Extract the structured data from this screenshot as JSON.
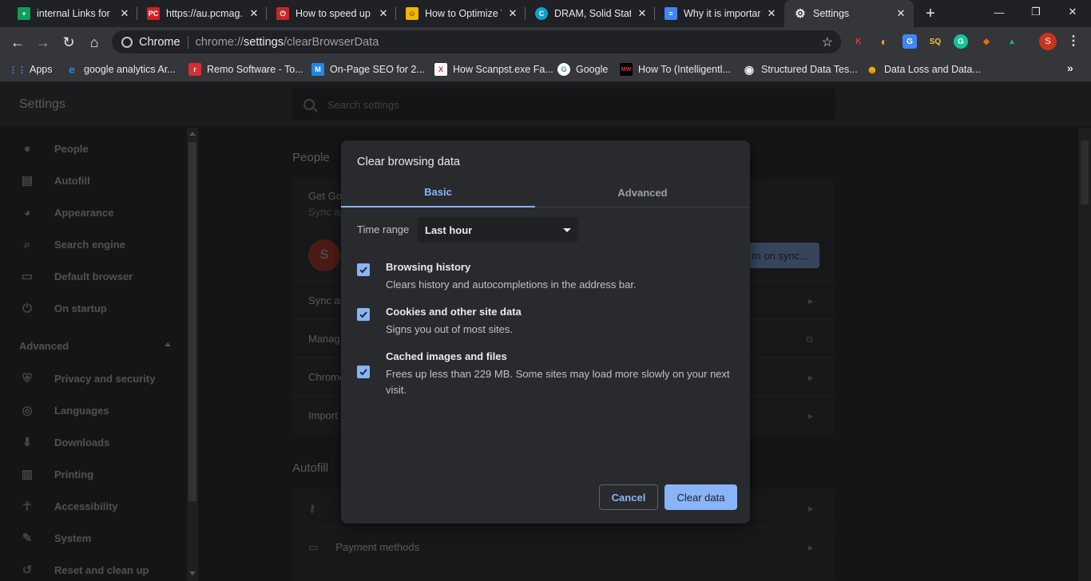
{
  "tabs": [
    {
      "title": "internal Links for P",
      "favicon": "sheets-icon",
      "color": "#0f9d58",
      "glyph": "+"
    },
    {
      "title": "https://au.pcmag.c",
      "favicon": "pcmag-icon",
      "color": "#d21f26",
      "glyph": "PC"
    },
    {
      "title": "How to speed up W",
      "favicon": "power-icon",
      "color": "#c62828",
      "glyph": "⏻"
    },
    {
      "title": "How to Optimize W",
      "favicon": "smiley-icon",
      "color": "#f4b400",
      "glyph": "☺"
    },
    {
      "title": "DRAM, Solid State",
      "favicon": "c-icon",
      "color": "#0aa2d4",
      "glyph": "C"
    },
    {
      "title": "Why it is importan",
      "favicon": "docs-icon",
      "color": "#4285f4",
      "glyph": "≡"
    },
    {
      "title": "Settings",
      "favicon": "gear-icon",
      "color": "#35363a",
      "glyph": "⚙"
    }
  ],
  "window": {
    "minimize": "—",
    "restore": "❐",
    "close": "✕",
    "new_tab": "+"
  },
  "omnibox": {
    "chip": "Chrome",
    "url_scheme": "chrome://",
    "url_host": "settings",
    "url_path": "/clearBrowserData"
  },
  "extensions": [
    {
      "name": "k-extension-icon",
      "glyph": "K",
      "color": "#e53935"
    },
    {
      "name": "moon-extension-icon",
      "glyph": "◐",
      "color": "#f9a825"
    },
    {
      "name": "translate-extension-icon",
      "glyph": "G",
      "color": "#4285f4"
    },
    {
      "name": "sq-extension-icon",
      "glyph": "SQ",
      "color": "#fbc02d"
    },
    {
      "name": "grammarly-extension-icon",
      "glyph": "G",
      "color": "#15c39a"
    },
    {
      "name": "tag-extension-icon",
      "glyph": "◆",
      "color": "#ef6c00"
    },
    {
      "name": "hat-extension-icon",
      "glyph": "▲",
      "color": "#26a69a"
    }
  ],
  "profile_initial": "S",
  "bookmarks": [
    {
      "label": "Apps",
      "icon": "apps-grid-icon",
      "color": "#4285f4",
      "glyph": "⋮⋮"
    },
    {
      "label": "google analytics Ar...",
      "icon": "ie-icon",
      "color": "#1e88e5",
      "glyph": "e"
    },
    {
      "label": "Remo Software - To...",
      "icon": "remo-icon",
      "color": "#d32f2f",
      "glyph": "r"
    },
    {
      "label": "On-Page SEO for 2...",
      "icon": "m-icon",
      "color": "#1e88e5",
      "glyph": "M"
    },
    {
      "label": "How Scanpst.exe Fa...",
      "icon": "x-icon",
      "color": "#d32f2f",
      "glyph": "X"
    },
    {
      "label": "Google",
      "icon": "google-icon",
      "color": "#ffffff",
      "glyph": "G"
    },
    {
      "label": "How To (Intelligentl...",
      "icon": "mw-icon",
      "color": "#000000",
      "glyph": "MW"
    },
    {
      "label": "Structured Data Tes...",
      "icon": "globe-icon",
      "color": "#e8eaed",
      "glyph": "◉"
    },
    {
      "label": "Data Loss and Data...",
      "icon": "smiley-icon",
      "color": "#f4b400",
      "glyph": "☻"
    }
  ],
  "bookmarks_more": "»",
  "settings": {
    "title": "Settings",
    "search_placeholder": "Search settings",
    "sidebar": [
      {
        "label": "People",
        "icon": "person-icon",
        "glyph": "👤"
      },
      {
        "label": "Autofill",
        "icon": "clipboard-icon",
        "glyph": "📋"
      },
      {
        "label": "Appearance",
        "icon": "palette-icon",
        "glyph": "🎨"
      },
      {
        "label": "Search engine",
        "icon": "search-icon",
        "glyph": "⌕"
      },
      {
        "label": "Default browser",
        "icon": "browser-icon",
        "glyph": "▭"
      },
      {
        "label": "On startup",
        "icon": "power-icon",
        "glyph": "⏻"
      }
    ],
    "advanced_label": "Advanced",
    "advanced_items": [
      {
        "label": "Privacy and security",
        "icon": "shield-icon",
        "glyph": "⛨"
      },
      {
        "label": "Languages",
        "icon": "globe-icon",
        "glyph": "🌐"
      },
      {
        "label": "Downloads",
        "icon": "download-icon",
        "glyph": "⬇"
      },
      {
        "label": "Printing",
        "icon": "printer-icon",
        "glyph": "🖶"
      },
      {
        "label": "Accessibility",
        "icon": "accessibility-icon",
        "glyph": "♿"
      },
      {
        "label": "System",
        "icon": "wrench-icon",
        "glyph": "🔧"
      },
      {
        "label": "Reset and clean up",
        "icon": "history-icon",
        "glyph": "↺"
      }
    ],
    "people_title": "People",
    "people_rows": {
      "get_google": "Get Goo",
      "sync_sub": "Sync ar",
      "avatar": "S",
      "turn_on_sync": "rn on sync...",
      "sync_row": "Sync ar",
      "manage_row": "Manag",
      "chrome_row": "Chrome",
      "import_row": "Import"
    },
    "autofill_title": "Autofill",
    "autofill_rows": {
      "payment_methods": "Payment methods"
    }
  },
  "dialog": {
    "title": "Clear browsing data",
    "tab_basic": "Basic",
    "tab_advanced": "Advanced",
    "time_range_label": "Time range",
    "time_range_value": "Last hour",
    "options": [
      {
        "title": "Browsing history",
        "desc": "Clears history and autocompletions in the address bar.",
        "checked": true
      },
      {
        "title": "Cookies and other site data",
        "desc": "Signs you out of most sites.",
        "checked": true
      },
      {
        "title": "Cached images and files",
        "desc": "Frees up less than 229 MB. Some sites may load more slowly on your next visit.",
        "checked": true
      }
    ],
    "cancel": "Cancel",
    "clear": "Clear data",
    "accent": "#8ab4f8"
  }
}
